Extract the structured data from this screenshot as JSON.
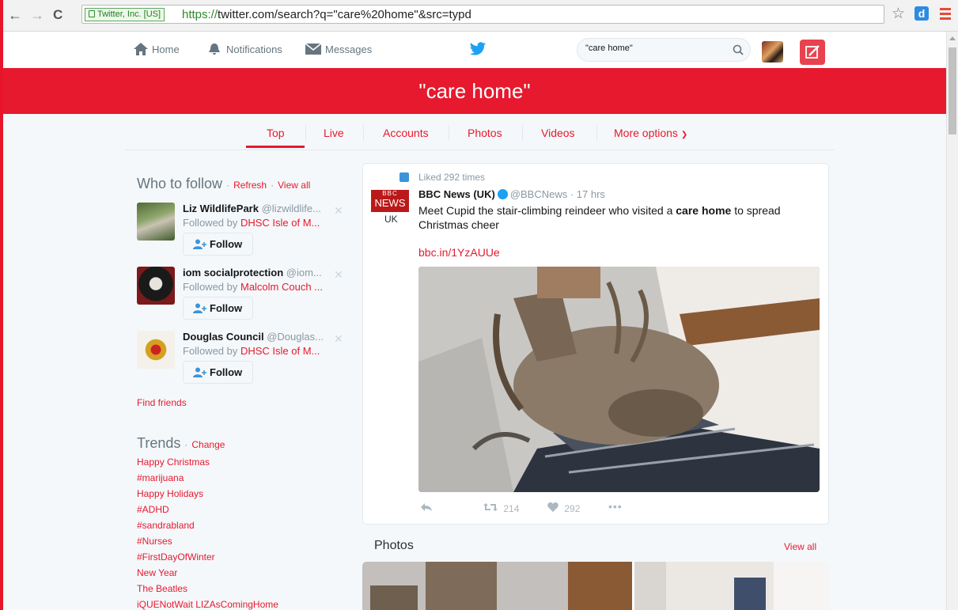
{
  "browser": {
    "secure_label": "Twitter, Inc. [US]",
    "url_scheme": "https://",
    "url_rest": "twitter.com/search?q=\"care%20home\"&src=typd",
    "ext_label": "d"
  },
  "nav": {
    "home": "Home",
    "notifications": "Notifications",
    "messages": "Messages",
    "search_value": "\"care home\""
  },
  "banner": {
    "query": "\"care home\""
  },
  "tabs": [
    {
      "label": "Top"
    },
    {
      "label": "Live"
    },
    {
      "label": "Accounts"
    },
    {
      "label": "Photos"
    },
    {
      "label": "Videos"
    },
    {
      "label": "More options"
    }
  ],
  "who_to_follow": {
    "title": "Who to follow",
    "refresh": "Refresh",
    "view_all": "View all",
    "follow_label": "Follow",
    "accounts": [
      {
        "name": "Liz WildlifePark",
        "handle": "@lizwildlife...",
        "followed_by_prefix": "Followed by ",
        "followed_by": "DHSC Isle of M..."
      },
      {
        "name": "iom socialprotection",
        "handle": "@iom...",
        "followed_by_prefix": "Followed by ",
        "followed_by": "Malcolm Couch ..."
      },
      {
        "name": "Douglas Council",
        "handle": "@Douglas...",
        "followed_by_prefix": "Followed by ",
        "followed_by": "DHSC Isle of M..."
      }
    ],
    "find_friends": "Find friends"
  },
  "trends": {
    "title": "Trends",
    "change": "Change",
    "items": [
      "Happy Christmas",
      "#marijuana",
      "Happy Holidays",
      "#ADHD",
      "#sandrabland",
      "#Nurses",
      "#FirstDayOfWinter",
      "New Year",
      "The Beatles",
      "iQUENotWait LIZAsComingHome"
    ]
  },
  "tweet": {
    "liked": "Liked 292 times",
    "logo_top": "BBC",
    "logo_bottom": "NEWS",
    "logo_region": "UK",
    "author": "BBC News (UK)",
    "handle": "@BBCNews",
    "time": "17 hrs",
    "text_before": "Meet Cupid the stair-climbing reindeer who visited a ",
    "text_bold": "care home",
    "text_after": " to spread Christmas cheer",
    "link": "bbc.in/1YzAUUe",
    "retweets": "214",
    "likes": "292"
  },
  "photos": {
    "title": "Photos",
    "view_all": "View all"
  },
  "colors": {
    "accent": "#e6192e",
    "link_blue": "#1da1f2",
    "bbc_red": "#bb1919"
  }
}
